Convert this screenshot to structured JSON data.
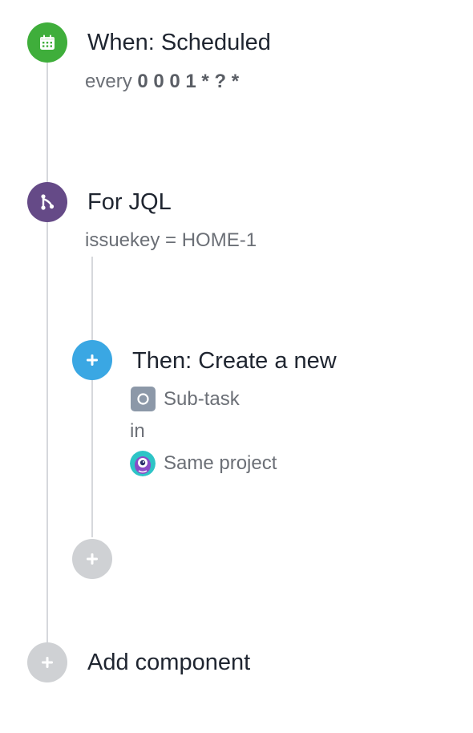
{
  "trigger": {
    "title": "When: Scheduled",
    "schedule_prefix": "every ",
    "schedule_value": "0 0 0 1 * ? *",
    "icon": "calendar-icon",
    "color": "#3fae3b"
  },
  "branch": {
    "title": "For JQL",
    "query": "issuekey = HOME-1",
    "icon": "branch-icon",
    "color": "#654a87"
  },
  "action": {
    "title": "Then: Create a new",
    "issue_type": "Sub-task",
    "in_label": "in",
    "project": "Same project",
    "icon": "plus-icon",
    "color": "#3aa7e3"
  },
  "branch_add": {
    "icon": "plus-icon",
    "color": "#cfd1d4"
  },
  "add_component": {
    "label": "Add component",
    "icon": "plus-icon",
    "color": "#cfd1d4"
  }
}
